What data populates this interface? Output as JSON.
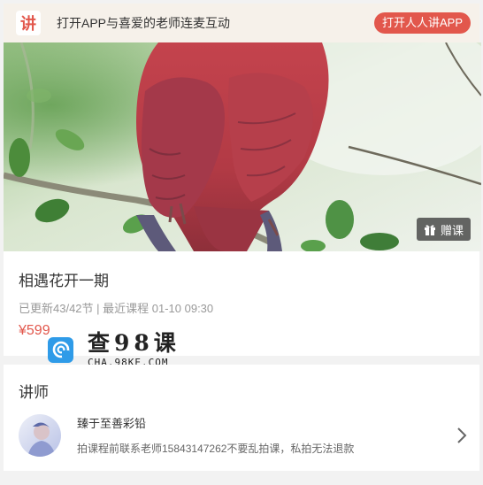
{
  "banner": {
    "logo_char": "讲",
    "text": "打开APP与喜爱的老师连麦互动",
    "open_label": "打开人人讲APP"
  },
  "hero": {
    "gift_label": "赠课"
  },
  "course": {
    "title": "相遇花开一期",
    "meta": "已更新43/42节 | 最近课程 01-10 09:30",
    "price": "¥599"
  },
  "watermark": {
    "title": "查98课",
    "url": "CHA.98KE.COM"
  },
  "teacher": {
    "section_title": "讲师",
    "name": "臻于至善彩铅",
    "description": "拍课程前联系老师15843147262不要乱拍课，私拍无法退款"
  },
  "colors": {
    "accent": "#e2574c",
    "banner_bg": "#f6f1ea",
    "watermark_blue": "#2f9be8"
  },
  "icons": [
    "gift-icon",
    "chevron-right-icon",
    "app-logo-icon",
    "watermark-logo-icon"
  ]
}
